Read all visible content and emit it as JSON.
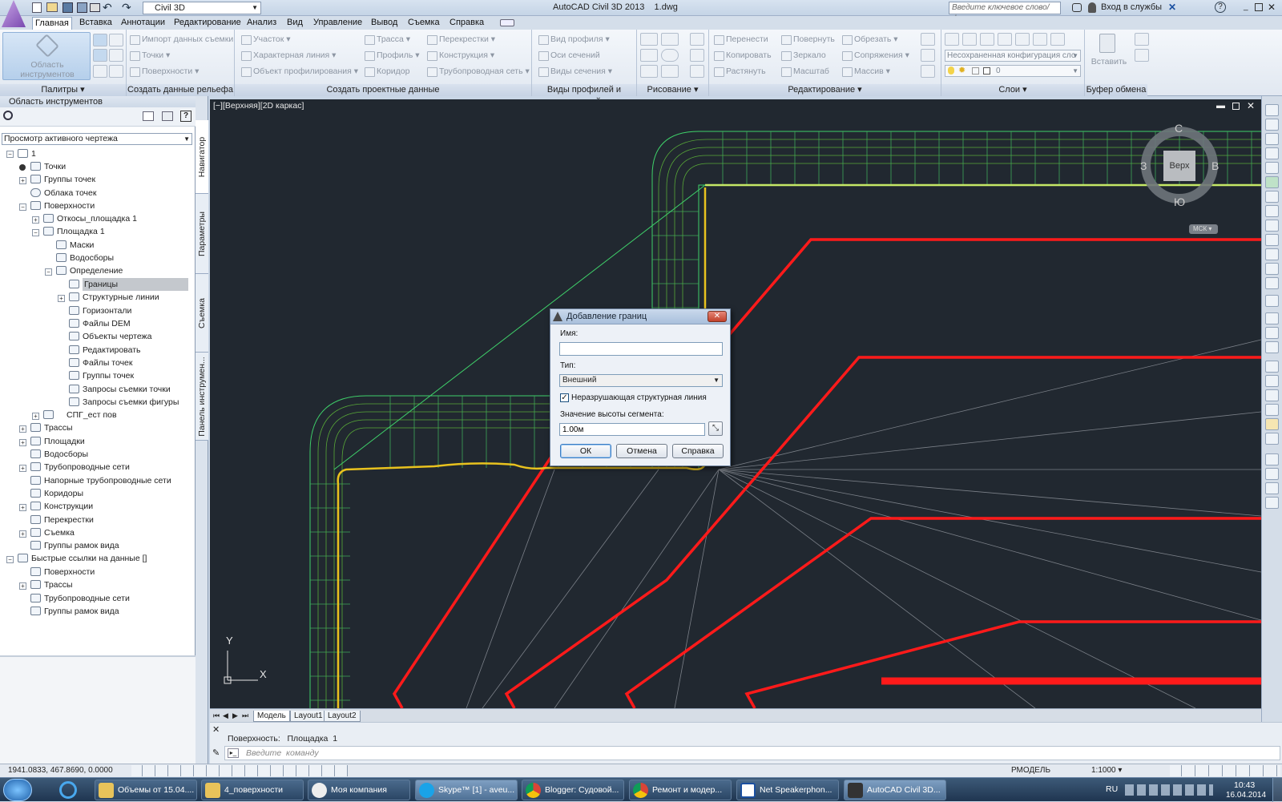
{
  "titlebar": {
    "workspace": "Civil 3D",
    "app_title": "AutoCAD Civil 3D 2013    1.dwg",
    "search_placeholder": "Введите ключевое слово/фразу",
    "signin": "Вход в службы"
  },
  "ribbon_tabs": [
    "Главная",
    "Вставка",
    "Аннотации",
    "Редактирование",
    "Анализ",
    "Вид",
    "Управление",
    "Вывод",
    "Съемка",
    "Справка"
  ],
  "ribbon": {
    "toolspace_button": "Область инструментов",
    "groups": {
      "palettes": "Палитры",
      "create_ground": "Создать данные рельефа",
      "create_design": "Создать проектные данные",
      "profile_section": "Виды профилей и сечений",
      "draw": "Рисование",
      "modify": "Редактирование",
      "layers": "Слои",
      "clipboard": "Буфер обмена"
    },
    "ground_items": [
      "Импорт данных съемки",
      "Точки",
      "Поверхности"
    ],
    "design_col1": [
      "Участок",
      "Характерная линия",
      "Объект профилирования"
    ],
    "design_col2": [
      "Трасса",
      "Профиль",
      "Коридор"
    ],
    "design_col3": [
      "Перекрестки",
      "Конструкция",
      "Трубопроводная сеть"
    ],
    "profile_items": [
      "Вид профиля",
      "Оси сечений",
      "Виды сечения"
    ],
    "modify_col1": [
      "Перенести",
      "Копировать",
      "Растянуть"
    ],
    "modify_col2": [
      "Повернуть",
      "Зеркало",
      "Масштаб"
    ],
    "modify_col3": [
      "Обрезать",
      "Сопряжения",
      "Массив"
    ],
    "layer_state": "Несохраненная конфигурация сло",
    "layer_current": "0",
    "paste": "Вставить"
  },
  "toolspace": {
    "title": "Область инструментов",
    "view_select": "Просмотр активного чертежа",
    "tabs": [
      "Навигатор",
      "Параметры",
      "Съемка",
      "Панель инструмен..."
    ],
    "tree": [
      {
        "label": "1",
        "level": 0
      },
      {
        "label": "Точки",
        "level": 1
      },
      {
        "label": "Группы точек",
        "level": 1
      },
      {
        "label": "Облака точек",
        "level": 1
      },
      {
        "label": "Поверхности",
        "level": 1
      },
      {
        "label": "Откосы_площадка 1",
        "level": 2
      },
      {
        "label": "Площадка 1",
        "level": 2
      },
      {
        "label": "Маски",
        "level": 3
      },
      {
        "label": "Водосборы",
        "level": 3
      },
      {
        "label": "Определение",
        "level": 3
      },
      {
        "label": "Границы",
        "level": 4,
        "selected": true
      },
      {
        "label": "Структурные линии",
        "level": 4
      },
      {
        "label": "Горизонтали",
        "level": 4
      },
      {
        "label": "Файлы DEM",
        "level": 4
      },
      {
        "label": "Объекты чертежа",
        "level": 4
      },
      {
        "label": "Редактировать",
        "level": 4
      },
      {
        "label": "Файлы точек",
        "level": 4
      },
      {
        "label": "Группы точек",
        "level": 4
      },
      {
        "label": "Запросы съемки точки",
        "level": 4
      },
      {
        "label": "Запросы съемки фигуры",
        "level": 4
      },
      {
        "label": "СПГ_ест пов",
        "level": 2
      },
      {
        "label": "Трассы",
        "level": 1
      },
      {
        "label": "Площадки",
        "level": 1
      },
      {
        "label": "Водосборы",
        "level": 1
      },
      {
        "label": "Трубопроводные сети",
        "level": 1
      },
      {
        "label": "Напорные трубопроводные сети",
        "level": 1
      },
      {
        "label": "Коридоры",
        "level": 1
      },
      {
        "label": "Конструкции",
        "level": 1
      },
      {
        "label": "Перекрестки",
        "level": 1
      },
      {
        "label": "Съемка",
        "level": 1
      },
      {
        "label": "Группы рамок вида",
        "level": 1
      },
      {
        "label": "Быстрые ссылки на данные []",
        "level": 0
      },
      {
        "label": "Поверхности",
        "level": 1
      },
      {
        "label": "Трассы",
        "level": 1
      },
      {
        "label": "Трубопроводные сети",
        "level": 1
      },
      {
        "label": "Группы рамок вида",
        "level": 1
      }
    ]
  },
  "viewport": {
    "header": "[−][Верхняя][2D каркас]",
    "viewcube": {
      "top": "Верх",
      "n": "С",
      "s": "Ю",
      "w": "З",
      "e": "В",
      "ucs": "МСК"
    },
    "axis_x": "X",
    "axis_y": "Y"
  },
  "layout_tabs": [
    "Модель",
    "Layout1",
    "Layout2"
  ],
  "command": {
    "history": "Поверхность:   Площадка  1",
    "placeholder": "Введите  команду"
  },
  "statusbar": {
    "coords": "1941.0833, 467.8690, 0.0000",
    "model": "РМОДЕЛЬ",
    "scale": "1:1000"
  },
  "dialog": {
    "title": "Добавление границ",
    "name_label": "Имя:",
    "name_value": "",
    "type_label": "Тип:",
    "type_value": "Внешний",
    "checkbox_label": "Неразрушающая структурная линия",
    "checkbox_checked": true,
    "segment_label": "Значение высоты сегмента:",
    "segment_value": "1.00м",
    "ok": "ОК",
    "cancel": "Отмена",
    "help": "Справка"
  },
  "taskbar": {
    "items": [
      "Объемы от 15.04....",
      "4_поверхности",
      "Моя компания",
      "Skype™ [1] - aveu...",
      "Blogger: Судовой...",
      "Ремонт и модер...",
      "Net Speakerphon...",
      "AutoCAD Civil 3D..."
    ],
    "lang": "RU",
    "time": "10:43",
    "date": "16.04.2014"
  },
  "colors": {
    "drawing_bg": "#212830",
    "boundary": "#ff1a1a",
    "surface_edge": "#e9c21e",
    "grid": "#3fd16a"
  }
}
